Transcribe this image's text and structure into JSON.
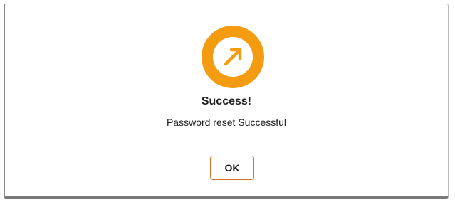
{
  "dialog": {
    "icon": "arrow-up-right-icon",
    "title": "Success!",
    "message": "Password reset Successful",
    "ok_label": "OK"
  },
  "colors": {
    "accent": "#f39c12",
    "button_border": "#d4722a",
    "text": "#222222"
  }
}
